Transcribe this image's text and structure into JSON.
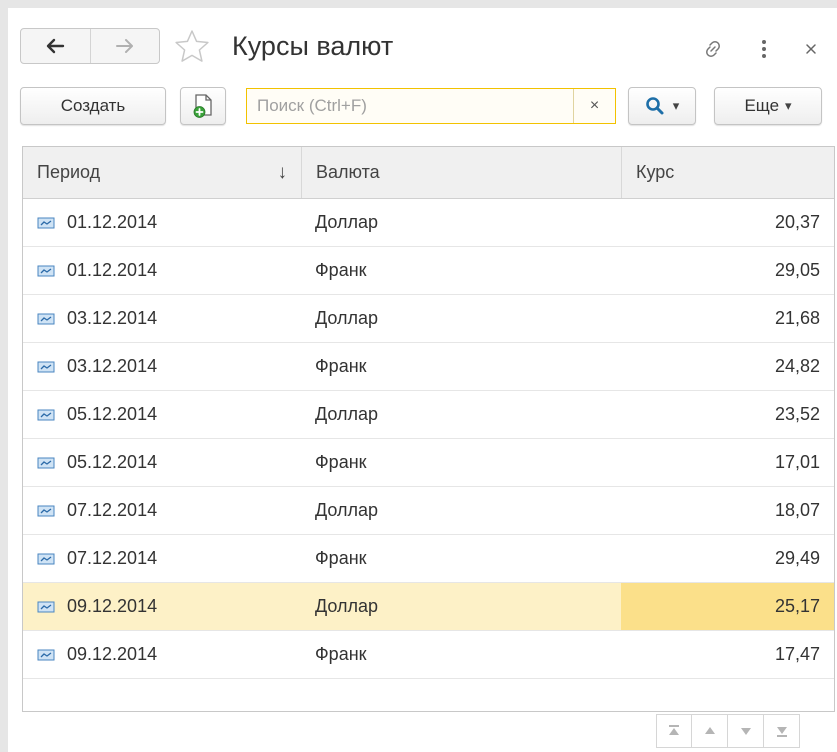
{
  "window": {
    "title": "Курсы валют"
  },
  "toolbar": {
    "create_label": "Создать",
    "search_placeholder": "Поиск (Ctrl+F)",
    "search_value": "",
    "clear_glyph": "×",
    "more_label": "Еще",
    "dropdown_glyph": "▾"
  },
  "table": {
    "columns": [
      "Период",
      "Валюта",
      "Курс"
    ],
    "sort_indicator": "↓",
    "rows": [
      {
        "period": "01.12.2014",
        "currency": "Доллар",
        "rate": "20,37"
      },
      {
        "period": "01.12.2014",
        "currency": "Франк",
        "rate": "29,05"
      },
      {
        "period": "03.12.2014",
        "currency": "Доллар",
        "rate": "21,68"
      },
      {
        "period": "03.12.2014",
        "currency": "Франк",
        "rate": "24,82"
      },
      {
        "period": "05.12.2014",
        "currency": "Доллар",
        "rate": "23,52"
      },
      {
        "period": "05.12.2014",
        "currency": "Франк",
        "rate": "17,01"
      },
      {
        "period": "07.12.2014",
        "currency": "Доллар",
        "rate": "18,07"
      },
      {
        "period": "07.12.2014",
        "currency": "Франк",
        "rate": "29,49"
      },
      {
        "period": "09.12.2014",
        "currency": "Доллар",
        "rate": "25,17",
        "selected": true
      },
      {
        "period": "09.12.2014",
        "currency": "Франк",
        "rate": "17,47"
      }
    ]
  },
  "icons": {
    "back": "arrow-left-icon",
    "forward": "arrow-right-icon",
    "favorite": "star-icon",
    "link": "link-icon",
    "more": "more-vertical-icon",
    "close": "close-icon",
    "copy": "copy-icon",
    "search": "search-icon",
    "row": "register-record-icon",
    "pager": [
      "first-page-icon",
      "previous-page-icon",
      "next-page-icon",
      "last-page-icon"
    ]
  },
  "colors": {
    "accent_yellow": "#f2c200",
    "selected_row": "#fdf1c7",
    "selected_cell": "#fbe08a",
    "search_icon": "#1e6fa8",
    "copy_icon_green": "#3aa23a"
  }
}
